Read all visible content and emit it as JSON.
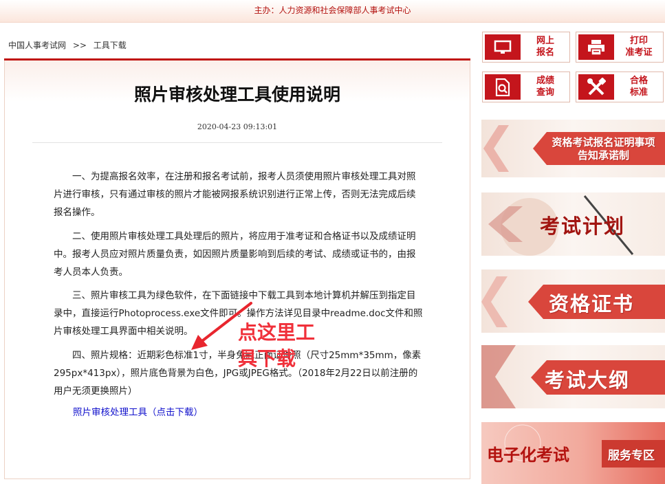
{
  "header": {
    "sponsor": "主办：人力资源和社会保障部人事考试中心"
  },
  "breadcrumb": {
    "home": "中国人事考试网",
    "sep": ">>",
    "current": "工具下载"
  },
  "article": {
    "title": "照片审核处理工具使用说明",
    "date": "2020-04-23 09:13:01",
    "paragraphs": [
      "一、为提高报名效率，在注册和报名考试前，报考人员须使用照片审核处理工具对照片进行审核，只有通过审核的照片才能被网报系统识别进行正常上传，否则无法完成后续报名操作。",
      "二、使用照片审核处理工具处理后的照片，将应用于准考证和合格证书以及成绩证明中。报考人员应对照片质量负责，如因照片质量影响到后续的考试、成绩或证书的，由报考人员本人负责。",
      "三、照片审核工具为绿色软件，在下面链接中下载工具到本地计算机并解压到指定目录中，直接运行Photoprocess.exe文件即可。操作方法详见目录中readme.doc文件和照片审核处理工具界面中相关说明。",
      "四、照片规格：近期彩色标准1寸，半身免冠正面证件照（尺寸25mm*35mm，像素295px*413px），照片底色背景为白色，JPG或JPEG格式。（2018年2月22日以前注册的用户无须更换照片）"
    ],
    "download_link": "照片审核处理工具（点击下载）"
  },
  "annotation": {
    "line1": "点这里工",
    "line2": "具下载",
    "color": "#f0303a"
  },
  "quick_buttons": [
    {
      "label1": "网上",
      "label2": "报名",
      "icon": "monitor-icon"
    },
    {
      "label1": "打印",
      "label2": "准考证",
      "icon": "printer-icon"
    },
    {
      "label1": "成绩",
      "label2": "查询",
      "icon": "search-doc-icon"
    },
    {
      "label1": "合格",
      "label2": "标准",
      "icon": "tools-icon"
    }
  ],
  "banners": {
    "cert_promise_line1": "资格考试报名证明事项",
    "cert_promise_line2": "告知承诺制",
    "exam_plan": "考试计划",
    "qualification": "资格证书",
    "syllabus": "考试大纲",
    "ecomputer_main": "电子化考试",
    "ecomputer_sub": "服务专区"
  },
  "colors": {
    "brand_red": "#c4151c",
    "link_blue": "#1111cc"
  }
}
